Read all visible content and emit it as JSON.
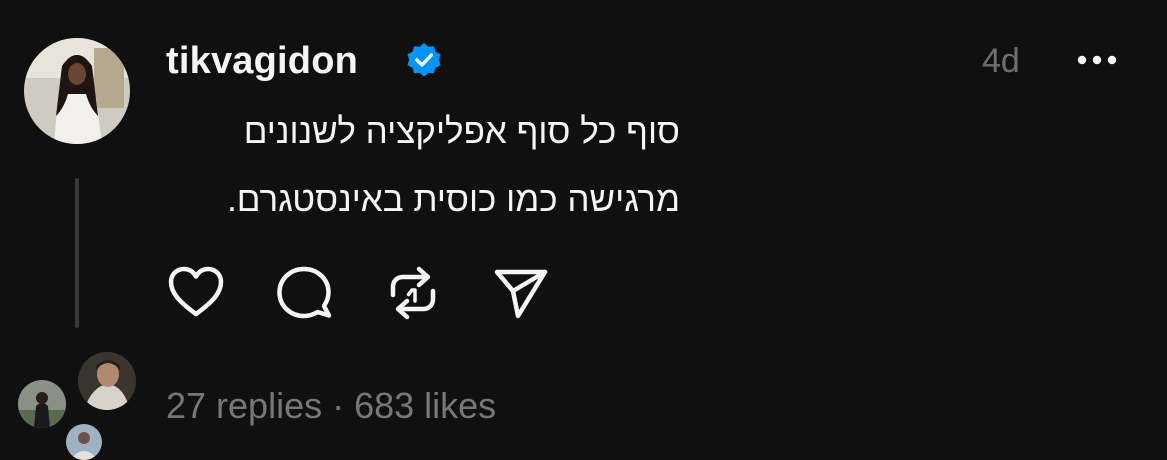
{
  "post": {
    "username": "tikvagidon",
    "verified_icon": "verified-badge-icon",
    "timestamp": "4d",
    "more_icon": "more-options-icon",
    "text_lines": [
      "סוף כל סוף אפליקציה לשנונים",
      "מרגישה כמו כוסית באינסטגרם."
    ]
  },
  "actions": [
    {
      "icon": "heart-icon"
    },
    {
      "icon": "comment-icon"
    },
    {
      "icon": "repost-icon"
    },
    {
      "icon": "share-icon"
    }
  ],
  "footer": {
    "replies": "27 replies",
    "separator": "·",
    "likes": "683 likes"
  },
  "colors": {
    "background": "#101010",
    "text_primary": "#f3f5f7",
    "text_secondary": "#777777",
    "verified_blue": "#0095f6",
    "thread_line": "#3a3a3a"
  }
}
